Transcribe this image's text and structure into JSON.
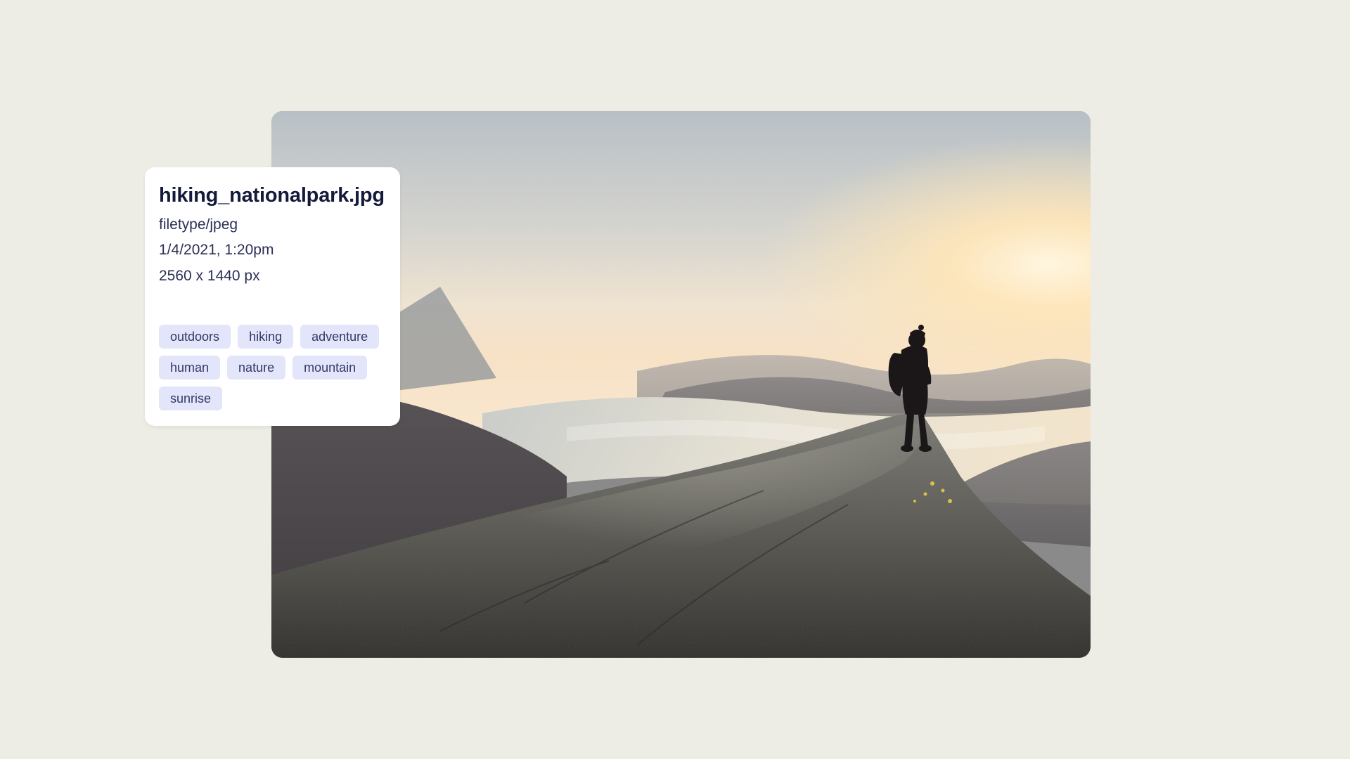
{
  "card": {
    "filename": "hiking_nationalpark.jpg",
    "filetype": "filetype/jpeg",
    "timestamp": "1/4/2021, 1:20pm",
    "dimensions": "2560 x 1440 px",
    "tags": [
      "outdoors",
      "hiking",
      "adventure",
      "human",
      "nature",
      "mountain",
      "sunrise"
    ]
  }
}
